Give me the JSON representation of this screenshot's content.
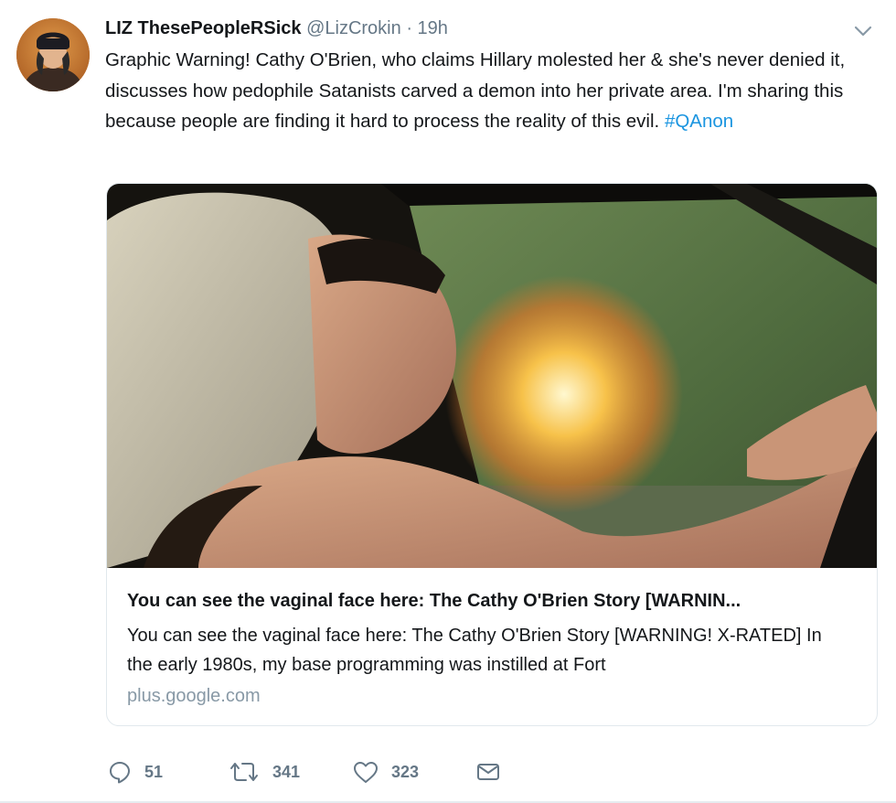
{
  "tweet": {
    "author_name": "LIZ ThesePeopleRSick",
    "handle": "@LizCrokin",
    "separator": "·",
    "time": "19h",
    "text": "Graphic Warning! Cathy O'Brien, who claims Hillary molested her & she's never denied it, discusses how pedophile Satanists carved a demon into her private area. I'm sharing this because people are finding it hard to process the reality of this evil.",
    "hashtag": "#QAnon"
  },
  "card": {
    "title": "You can see the vaginal face here: The Cathy O'Brien Story [WARNIN...",
    "description": "You can see the vaginal face here: The Cathy O'Brien Story [WARNING! X-RATED] In the early 1980s, my base programming was instilled at Fort",
    "domain": "plus.google.com"
  },
  "actions": {
    "reply_count": "51",
    "retweet_count": "341",
    "like_count": "323"
  },
  "colors": {
    "link": "#1b95e0",
    "secondary_text": "#657786",
    "domain_text": "#8899a6",
    "border": "#e1e8ed"
  },
  "icons": [
    "chevron-down-icon",
    "reply-icon",
    "retweet-icon",
    "like-icon",
    "direct-message-icon"
  ]
}
